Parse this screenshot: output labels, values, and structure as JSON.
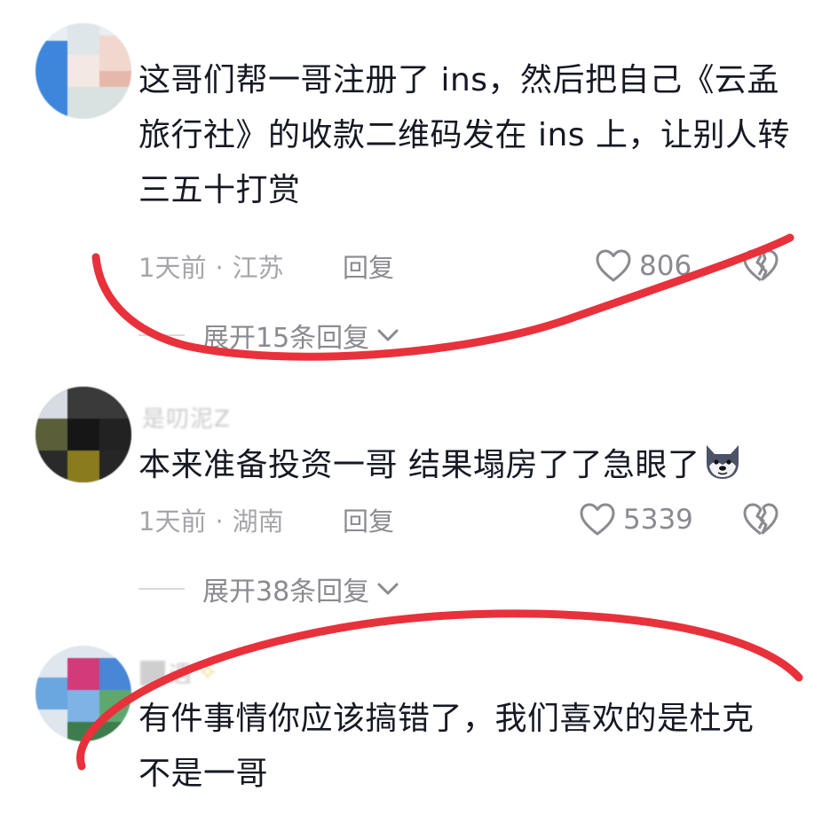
{
  "comments": [
    {
      "text": "这哥们帮一哥注册了 ins，然后把自己《云孟旅行社》的收款二维码发在 ins 上，让别人转三五十打赏",
      "time": "1天前",
      "dot": "·",
      "location": "江苏",
      "reply_label": "回复",
      "likes": "806",
      "expand_label": "展开15条回复"
    },
    {
      "username": "是叨泥Z",
      "text": "本来准备投资一哥  结果塌房了了急眼了",
      "time": "1天前",
      "dot": "·",
      "location": "湖南",
      "reply_label": "回复",
      "likes": "5339",
      "expand_label": "展开38条回复"
    },
    {
      "username": "遇",
      "text": "有件事情你应该搞错了，我们喜欢的是杜克不是一哥"
    }
  ],
  "colors": {
    "text": "#161823",
    "meta": "#a6a6aa",
    "annotation": "#e8313b"
  }
}
